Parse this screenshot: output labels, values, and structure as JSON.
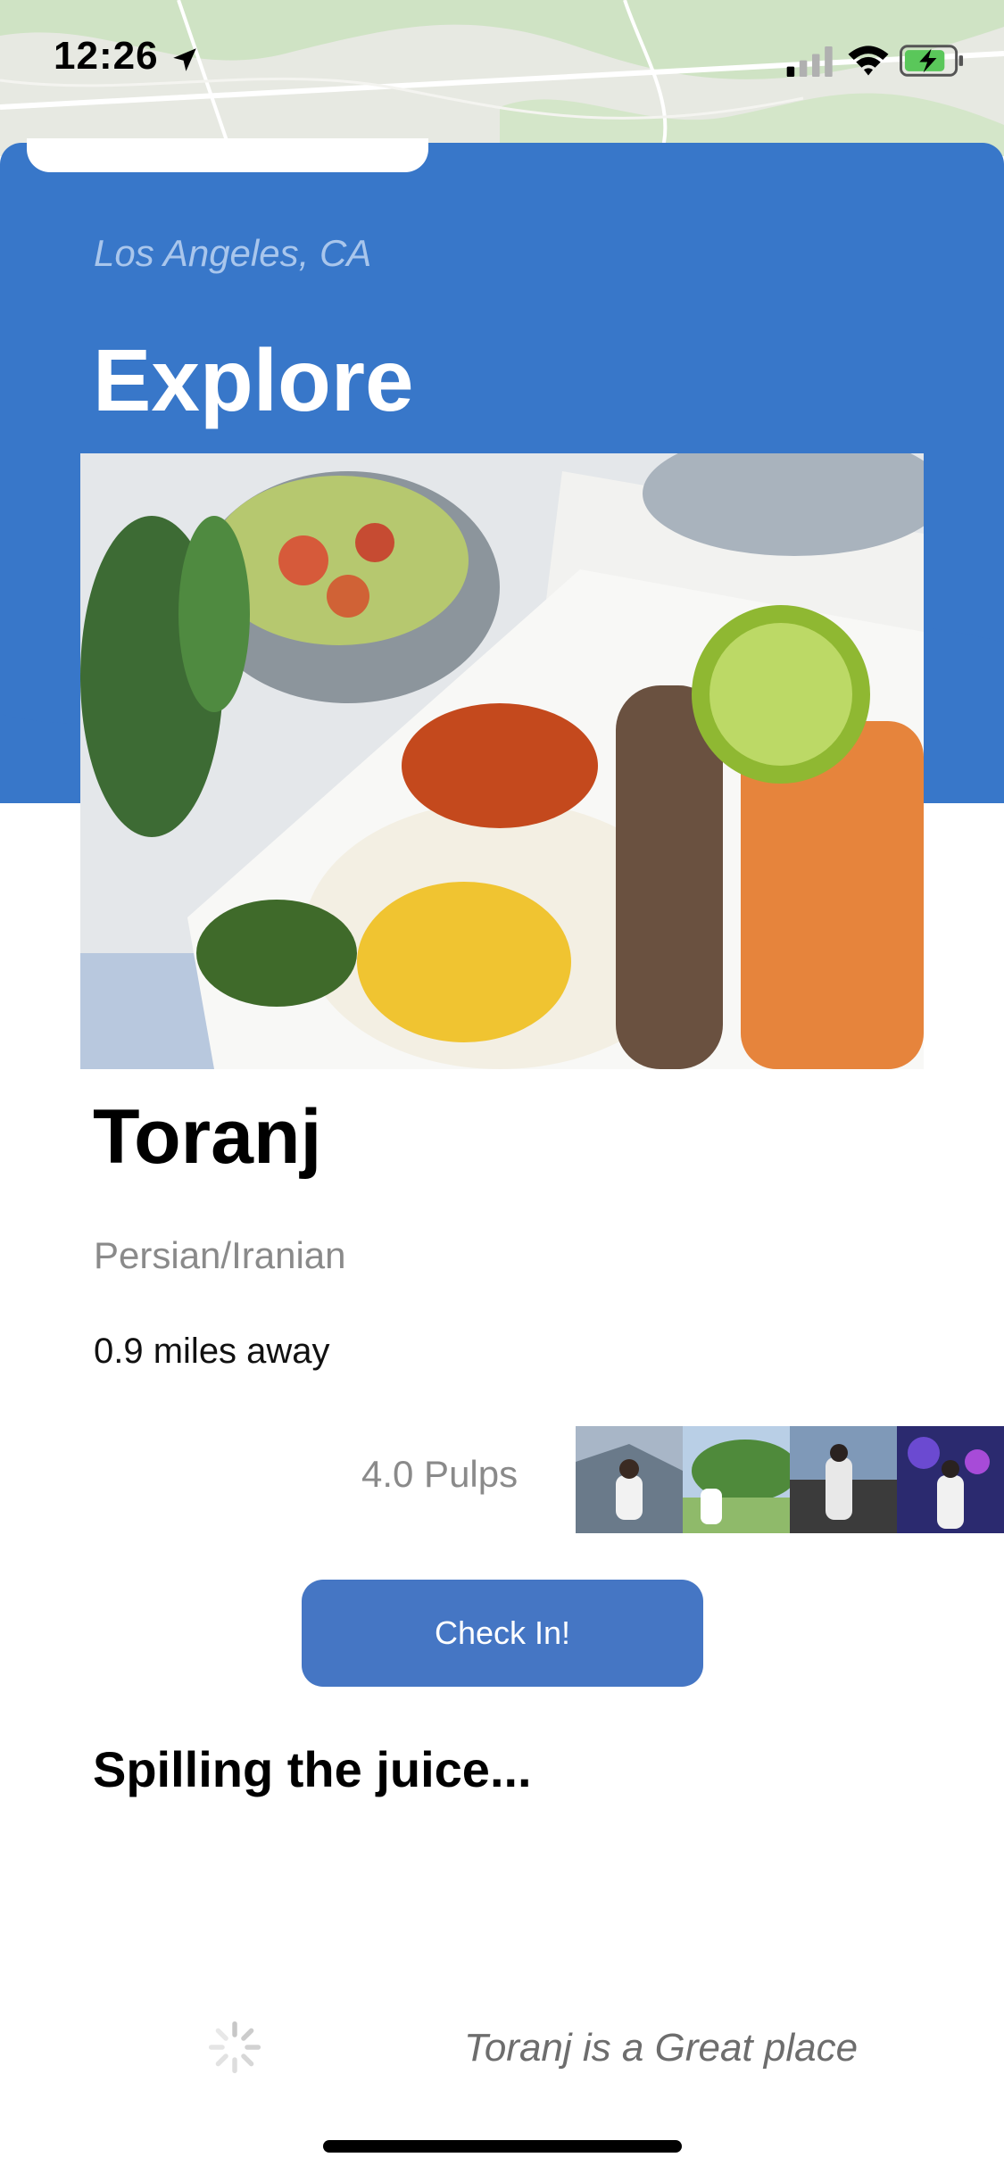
{
  "status_bar": {
    "time": "12:26",
    "icons": [
      "location-arrow-icon",
      "cellular-signal-icon",
      "wifi-icon",
      "battery-charging-icon"
    ]
  },
  "header": {
    "city": "Los Angeles, CA",
    "title": "Explore",
    "color": "#3877c9"
  },
  "restaurant": {
    "name": "Toranj",
    "cuisine": "Persian/Iranian",
    "distance": "0.9 miles away",
    "rating": "4.0 Pulps",
    "photo": "food-photo",
    "gallery": [
      "user-photo-1",
      "user-photo-2",
      "user-photo-3",
      "user-photo-4"
    ]
  },
  "actions": {
    "check_in_label": "Check In!",
    "button_color": "#4576c4"
  },
  "reviews": {
    "section_title": "Spilling the juice...",
    "items": [
      {
        "text": "Toranj is a Great place"
      }
    ]
  }
}
